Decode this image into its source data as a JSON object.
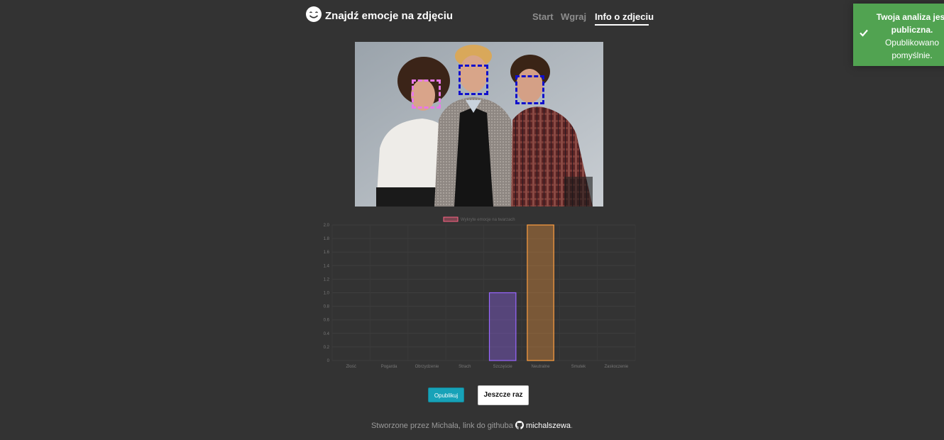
{
  "header": {
    "logo_icon": "smile-icon",
    "brand": "Znajdź emocje na zdjęciu",
    "nav": [
      {
        "label": "Start",
        "active": false
      },
      {
        "label": "Wgraj",
        "active": false
      },
      {
        "label": "Info o zdjeciu",
        "active": true
      }
    ]
  },
  "toast": {
    "icon": "check-icon",
    "title": "Twoja analiza jest publiczna.",
    "message": "Opublikowano pomyślnie.",
    "color": "#51a351"
  },
  "photo": {
    "face_boxes": [
      {
        "color": "#e879e8"
      },
      {
        "color": "#1010cc"
      },
      {
        "color": "#1010cc"
      }
    ]
  },
  "chart_data": {
    "type": "bar",
    "legend": "Wykryte emocje na twarzach",
    "categories": [
      "Złość",
      "Pogarda",
      "Obrzydzenie",
      "Strach",
      "Szczęście",
      "Neutralne",
      "Smutek",
      "Zaskoczenie"
    ],
    "values": [
      0,
      0,
      0,
      0,
      1,
      2,
      0,
      0
    ],
    "colors": [
      "#ff6384",
      "#36a2eb",
      "#ffce56",
      "#4bc0c0",
      "#9966ff",
      "#ff9f40",
      "#c9cbcf",
      "#ff6384"
    ],
    "yticks": [
      "0",
      "0.2",
      "0.4",
      "0.6",
      "0.8",
      "1.0",
      "1.2",
      "1.4",
      "1.6",
      "1.8",
      "2.0"
    ],
    "ylim": [
      0,
      2.0
    ]
  },
  "actions": {
    "publish_label": "Opublikuj",
    "again_label": "Jeszcze raz"
  },
  "footer": {
    "text": "Stworzone przez Michała, link do githuba ",
    "github_icon": "github-icon",
    "link_text": "michalszewa",
    "suffix": "."
  }
}
